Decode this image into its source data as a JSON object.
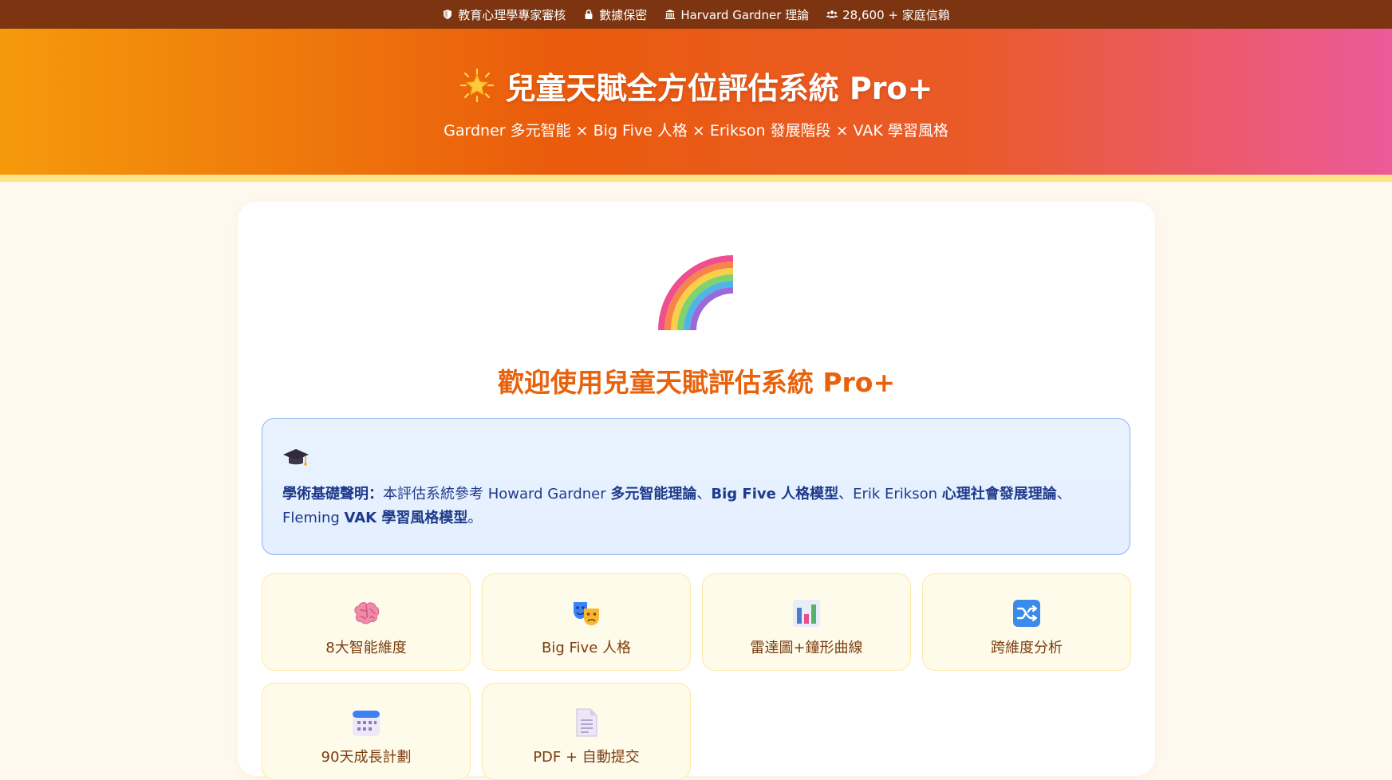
{
  "topbar": {
    "items": [
      {
        "label": "教育心理學專家審核",
        "icon": "shield-icon"
      },
      {
        "label": "數據保密",
        "icon": "lock-icon"
      },
      {
        "label": "Harvard Gardner 理論",
        "icon": "university-icon"
      },
      {
        "label": "28,600 + 家庭信賴",
        "icon": "users-icon"
      }
    ]
  },
  "hero": {
    "title": "兒童天賦全方位評估系統 Pro+",
    "subtitle": "Gardner 多元智能 × Big Five 人格 × Erikson 發展階段 × VAK 學習風格"
  },
  "main": {
    "welcome": "歡迎使用兒童天賦評估系統 Pro+",
    "notice": {
      "label": "學術基礎聲明：",
      "t1": "本評估系統參考 Howard Gardner ",
      "b1": "多元智能理論",
      "t2": "、",
      "b2": "Big Five 人格模型",
      "t3": "、Erik Erikson ",
      "b3": "心理社會發展理論",
      "t4": "、Fleming ",
      "b4": "VAK 學習風格模型",
      "t5": "。"
    },
    "features": [
      {
        "label": "8大智能維度",
        "icon": "brain-icon"
      },
      {
        "label": "Big Five 人格",
        "icon": "theater-masks-icon"
      },
      {
        "label": "雷達圖+鐘形曲線",
        "icon": "bar-chart-icon"
      },
      {
        "label": "跨維度分析",
        "icon": "shuffle-icon"
      },
      {
        "label": "90天成長計劃",
        "icon": "calendar-icon"
      },
      {
        "label": "PDF + 自動提交",
        "icon": "document-icon"
      }
    ]
  },
  "colors": {
    "topbar": "#7c3510",
    "accent": "#e8620c",
    "notice_text": "#1e3a8a",
    "feature_bg": "#fffbea"
  }
}
